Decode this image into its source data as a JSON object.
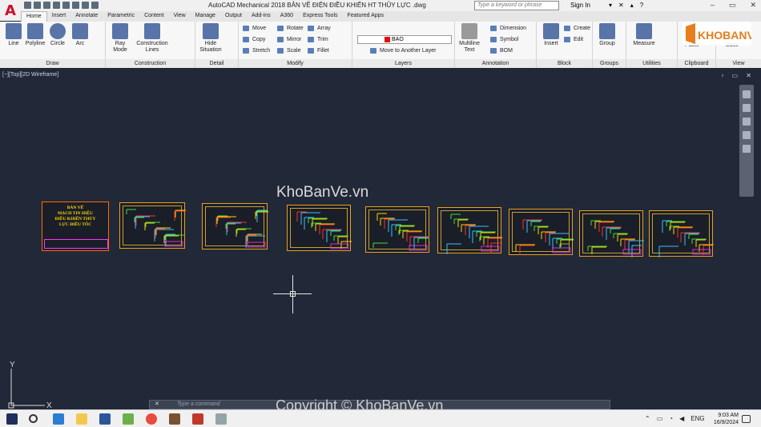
{
  "app": {
    "logo_letter": "A",
    "window_title": "AutoCAD Mechanical 2018    BẢN VẼ ĐIỆN ĐIỀU KHIỂN HT THỦY LỰC .dwg",
    "search_placeholder": "Type a keyword or phrase",
    "sign_in": "Sign In",
    "help": "?"
  },
  "tabs": [
    "Home",
    "Insert",
    "Annotate",
    "Parametric",
    "Content",
    "View",
    "Manage",
    "Output",
    "Add-ins",
    "A360",
    "Express Tools",
    "Featured Apps"
  ],
  "ribbon": {
    "draw": {
      "title": "Draw",
      "line": "Line",
      "polyline": "Polyline",
      "circle": "Circle",
      "arc": "Arc"
    },
    "construction": {
      "title": "Construction",
      "ray_mode": "Ray\nMode",
      "construction_lines": "Construction\nLines"
    },
    "detail": {
      "title": "Detail",
      "hide_situation": "Hide\nSituation"
    },
    "modify": {
      "title": "Modify",
      "move": "Move",
      "rotate": "Rotate",
      "array": "Array",
      "copy": "Copy",
      "mirror": "Mirror",
      "trim": "Trim",
      "stretch": "Stretch",
      "scale": "Scale",
      "fillet": "Fillet"
    },
    "layers": {
      "title": "Layers",
      "current_layer": "BAO",
      "move_to_layer": "Move to Another Layer"
    },
    "annotation": {
      "title": "Annotation",
      "multiline_text": "Multiline\nText",
      "dimension": "Dimension",
      "symbol": "Symbol",
      "bom": "BOM"
    },
    "block": {
      "title": "Block",
      "insert": "Insert",
      "create": "Create",
      "edit": "Edit"
    },
    "groups": {
      "title": "Groups",
      "group": "Group"
    },
    "utilities": {
      "title": "Utilities",
      "measure": "Measure"
    },
    "clipboard": {
      "title": "Clipboard",
      "paste": "Paste"
    },
    "view": {
      "title": "View",
      "base": "Base"
    }
  },
  "viewport": {
    "label": "[−][Top][2D Wireframe]",
    "controls": "▫ ▭ ✕",
    "watermark": "KhoBanVe.vn",
    "cover_sheet_text": "BẢN VẼ\nMẠCH TIN HIỆU\nĐIỀU KHIỂN THỦY\nLỰC ĐIỀU TỐC",
    "ucs_y": "Y",
    "ucs_x": "X"
  },
  "logo": {
    "text": "KHOBANVE"
  },
  "command_line": {
    "placeholder": "Type a command",
    "close": "✕"
  },
  "copyright": "Copyright © KhoBanVe.vn",
  "taskbar": {
    "lang": "ENG",
    "time": "9:03 AM",
    "date": "16/9/2024"
  }
}
